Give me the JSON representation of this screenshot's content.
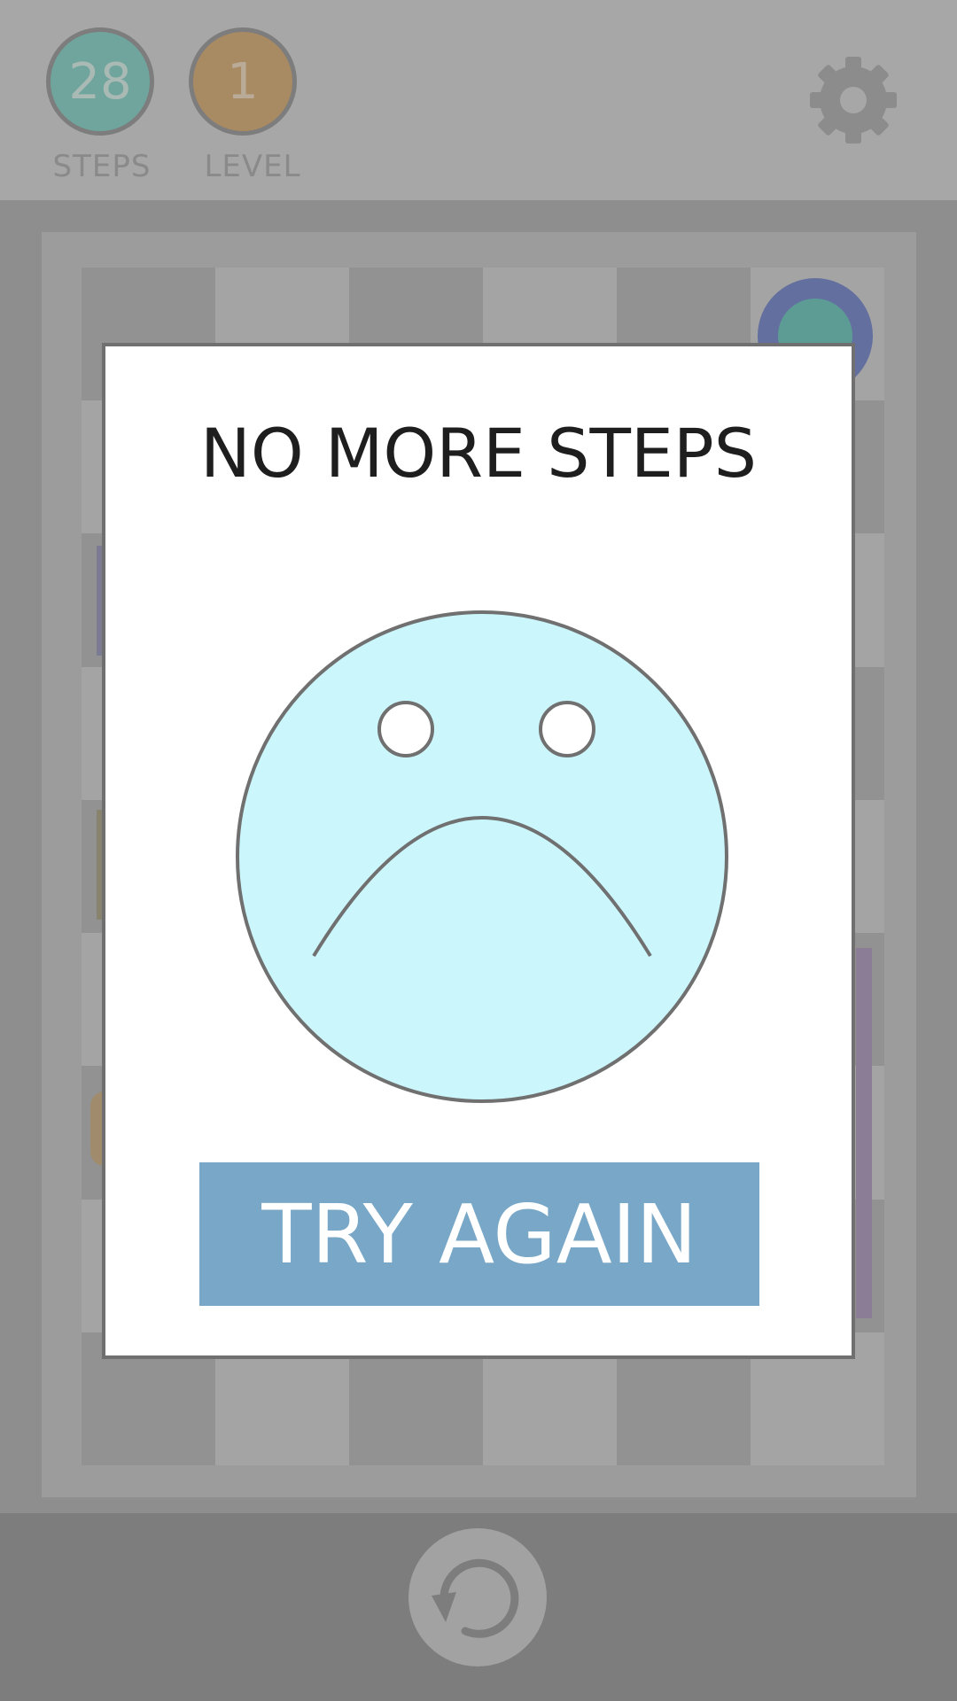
{
  "header": {
    "steps": {
      "value": "28",
      "label": "STEPS"
    },
    "level": {
      "value": "1",
      "label": "LEVEL"
    },
    "settings_icon": "gear-icon"
  },
  "board": {
    "columns": 6,
    "rows": 9,
    "colors": {
      "cell_dark": "#929292",
      "cell_light": "#a4a4a4",
      "piece_ring": "#636f9e",
      "piece_core": "#5c9c94"
    }
  },
  "footer": {
    "restart_icon": "restart-icon"
  },
  "dialog": {
    "title": "NO MORE STEPS",
    "icon": "sad-face-icon",
    "button_label": "TRY AGAIN",
    "colors": {
      "face_fill": "#cbf6fc",
      "button": "#78a7c7",
      "outline": "#707070"
    }
  }
}
